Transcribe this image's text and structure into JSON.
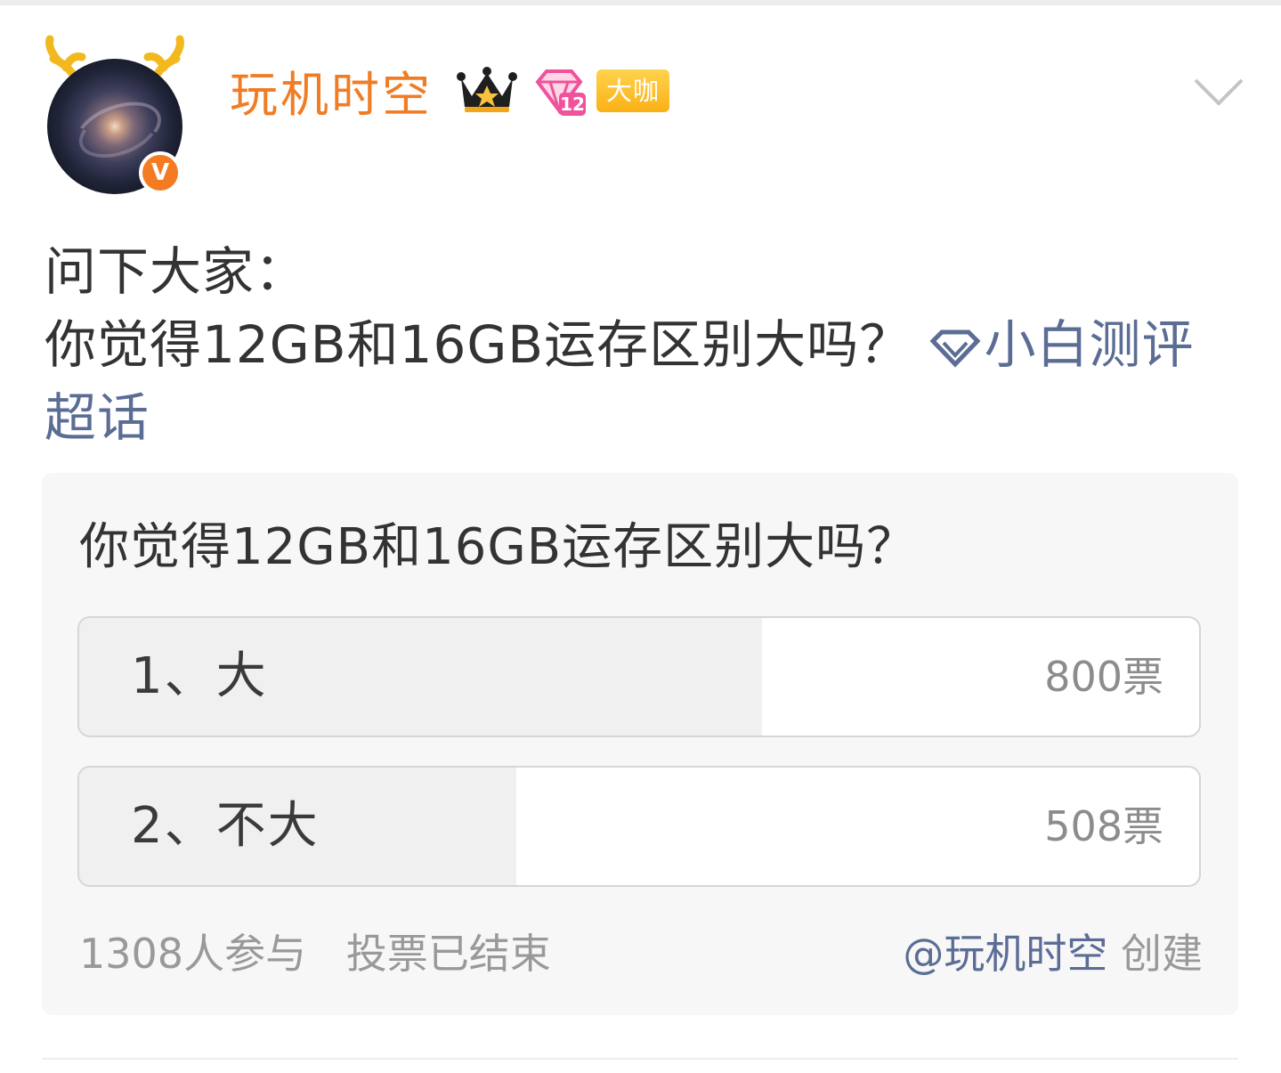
{
  "post": {
    "username": "玩机时空",
    "badge_label": "大咖",
    "verified_mark": "V",
    "text_line1": "问下大家：",
    "text_line2": "你觉得12GB和16GB运存区别大吗？",
    "topic_label": "小白测评超话"
  },
  "poll": {
    "question": "你觉得12GB和16GB运存区别大吗？",
    "options": [
      {
        "label": "1、大",
        "votes": "800票",
        "share": 0.61
      },
      {
        "label": "2、不大",
        "votes": "508票",
        "share": 0.39
      }
    ],
    "participants": "1308人参与",
    "status": "投票已结束",
    "creator": "@玩机时空",
    "creator_suffix": "创建"
  },
  "colors": {
    "username": "#f07d25",
    "link": "#5b6d95",
    "vbadge": "#f47b22",
    "daka_badge": "#fbb016"
  },
  "icons": [
    "antler-icon",
    "verified-v-icon",
    "crown-icon",
    "gem-level-icon",
    "chevron-down-icon",
    "topic-diamond-icon"
  ]
}
